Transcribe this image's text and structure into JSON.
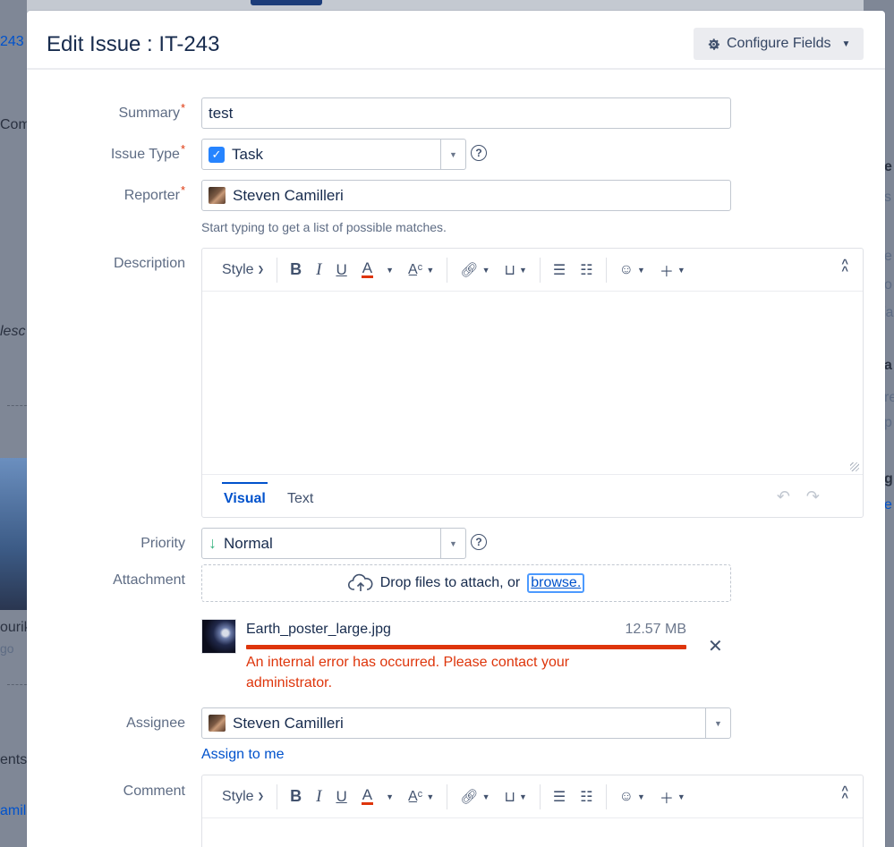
{
  "background": {
    "left_fragments": [
      "243",
      "Com",
      "lesc",
      "ourik",
      "go",
      "ents",
      "amil"
    ],
    "right_fragments": [
      "e",
      "s",
      "e",
      "o",
      "/a",
      "a",
      "re",
      "p",
      "g",
      "e"
    ]
  },
  "dialog": {
    "title": "Edit Issue : IT-243",
    "configure_fields_label": "Configure Fields"
  },
  "form": {
    "summary": {
      "label": "Summary",
      "required_mark": "*",
      "value": "test"
    },
    "issue_type": {
      "label": "Issue Type",
      "required_mark": "*",
      "value": "Task",
      "icon": "checkbox-icon"
    },
    "reporter": {
      "label": "Reporter",
      "required_mark": "*",
      "value": "Steven Camilleri",
      "hint": "Start typing to get a list of possible matches."
    },
    "description": {
      "label": "Description"
    },
    "priority": {
      "label": "Priority",
      "value": "Normal",
      "icon": "arrow-down-icon",
      "icon_color": "#36b37e"
    },
    "attachment": {
      "label": "Attachment",
      "dropzone_text": "Drop files to attach, or",
      "browse_label": "browse.",
      "file": {
        "name": "Earth_poster_large.jpg",
        "size": "12.57 MB",
        "error": "An internal error has occurred. Please contact your administrator.",
        "progress": 1.0,
        "status_color": "#de350b"
      }
    },
    "assignee": {
      "label": "Assignee",
      "value": "Steven Camilleri",
      "assign_to_me_label": "Assign to me"
    },
    "comment": {
      "label": "Comment"
    }
  },
  "editor": {
    "style_label": "Style",
    "bold_label": "B",
    "italic_label": "I",
    "underline_label": "U",
    "text_color_label": "A",
    "tabs": {
      "visual": "Visual",
      "text": "Text"
    }
  },
  "colors": {
    "accent": "#0052cc",
    "error": "#de350b",
    "required": "#de350b"
  }
}
